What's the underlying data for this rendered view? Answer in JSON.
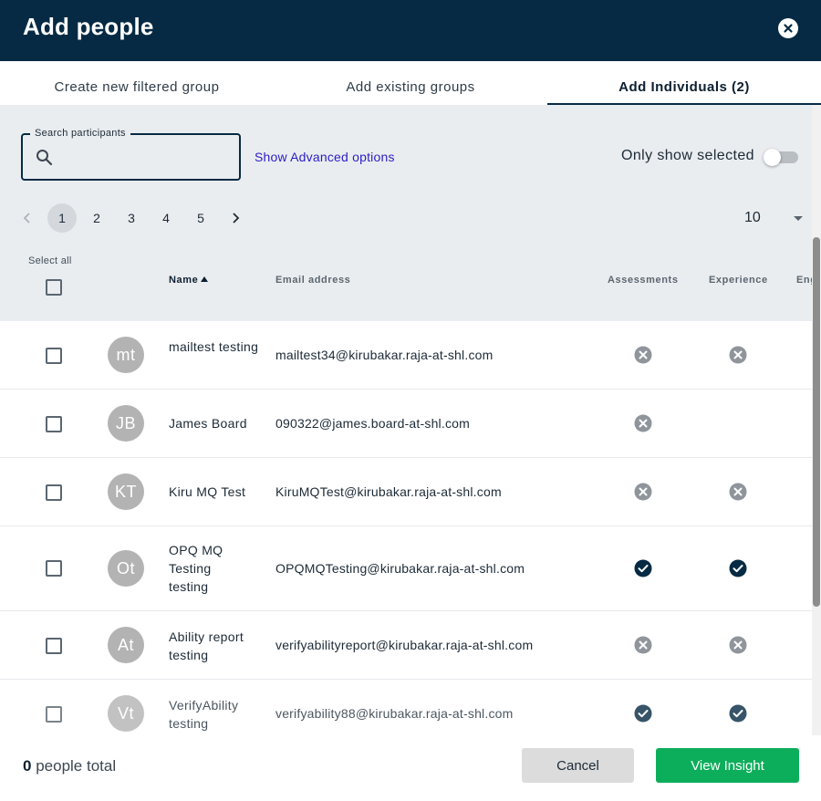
{
  "dialog": {
    "title": "Add people",
    "close_icon": "close-icon"
  },
  "tabs": [
    {
      "label": "Create new filtered group",
      "active": false
    },
    {
      "label": "Add existing groups",
      "active": false
    },
    {
      "label": "Add Individuals (2)",
      "active": true
    }
  ],
  "search": {
    "label": "Search participants",
    "value": "",
    "placeholder": "",
    "icon": "search-icon"
  },
  "advanced_link": "Show Advanced options",
  "only_show_selected": {
    "label": "Only show selected",
    "on": false
  },
  "pagination": {
    "pages": [
      "1",
      "2",
      "3",
      "4",
      "5"
    ],
    "current": "1",
    "prev_icon": "chevron-left-icon",
    "next_icon": "chevron-right-icon",
    "page_size": "10"
  },
  "table": {
    "select_all_label": "Select all",
    "columns": {
      "name": "Name",
      "email": "Email address",
      "assessments": "Assessments",
      "experience": "Experience",
      "engagement": "Eng"
    },
    "rows": [
      {
        "initials": "mt",
        "name": "mailtest testing",
        "email": "mailtest34@kirubakar.raja-at-shl.com",
        "assessments": "cross",
        "experience": "cross"
      },
      {
        "initials": "JB",
        "name": "James Board",
        "email": "090322@james.board-at-shl.com",
        "assessments": "cross",
        "experience": "none"
      },
      {
        "initials": "KT",
        "name": "Kiru MQ Test",
        "email": "KiruMQTest@kirubakar.raja-at-shl.com",
        "assessments": "cross",
        "experience": "cross"
      },
      {
        "initials": "Ot",
        "name": "OPQ MQ Testing testing",
        "email": "OPQMQTesting@kirubakar.raja-at-shl.com",
        "assessments": "check",
        "experience": "check"
      },
      {
        "initials": "At",
        "name": "Ability report testing",
        "email": "verifyabilityreport@kirubakar.raja-at-shl.com",
        "assessments": "cross",
        "experience": "cross"
      },
      {
        "initials": "Vt",
        "name": "VerifyAbility testing",
        "email": "verifyability88@kirubakar.raja-at-shl.com",
        "assessments": "check",
        "experience": "check"
      }
    ]
  },
  "footer": {
    "total_count": "0",
    "total_label": "people total",
    "cancel_label": "Cancel",
    "view_label": "View Insight"
  },
  "colors": {
    "header": "#062a43",
    "primary_button": "#0dae5b",
    "link": "#2b1ec4",
    "status_cross": "#8f959b",
    "status_check": "#062a43"
  }
}
